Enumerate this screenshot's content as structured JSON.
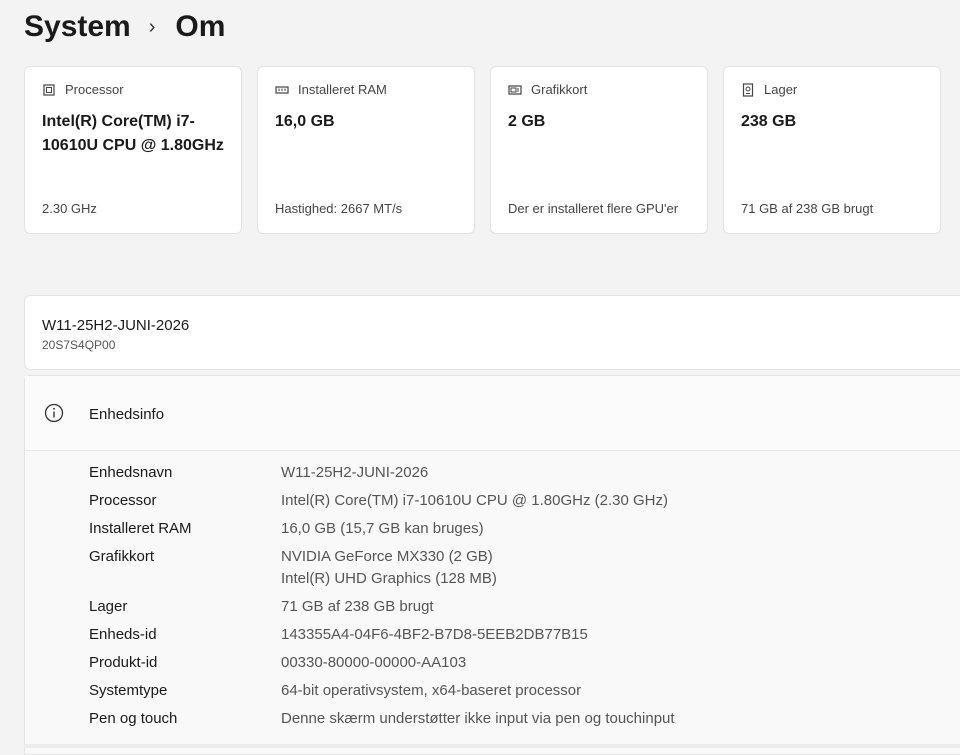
{
  "breadcrumb": {
    "parent": "System",
    "separator": "›",
    "current": "Om"
  },
  "cards": [
    {
      "icon": "processor-icon",
      "label": "Processor",
      "value": "Intel(R) Core(TM) i7-10610U CPU @ 1.80GHz",
      "sub": "2.30 GHz"
    },
    {
      "icon": "ram-icon",
      "label": "Installeret RAM",
      "value": "16,0 GB",
      "sub": "Hastighed: 2667 MT/s"
    },
    {
      "icon": "graphics-card-icon",
      "label": "Grafikkort",
      "value": "2 GB",
      "sub": "Der er installeret flere GPU'er"
    },
    {
      "icon": "storage-icon",
      "label": "Lager",
      "value": "238 GB",
      "sub": "71 GB af 238 GB brugt"
    }
  ],
  "device": {
    "name": "W11-25H2-JUNI-2026",
    "model": "20S7S4QP00"
  },
  "device_info": {
    "title": "Enhedsinfo",
    "rows": [
      {
        "label": "Enhedsnavn",
        "value": "W11-25H2-JUNI-2026"
      },
      {
        "label": "Processor",
        "value": "Intel(R) Core(TM) i7-10610U CPU @ 1.80GHz (2.30 GHz)"
      },
      {
        "label": "Installeret RAM",
        "value": "16,0 GB (15,7 GB kan bruges)"
      },
      {
        "label": "Grafikkort",
        "value": "NVIDIA GeForce MX330 (2 GB)",
        "value2": "Intel(R) UHD Graphics (128 MB)"
      },
      {
        "label": "Lager",
        "value": "71 GB af 238 GB brugt"
      },
      {
        "label": "Enheds-id",
        "value": "143355A4-04F6-4BF2-B7D8-5EEB2DB77B15"
      },
      {
        "label": "Produkt-id",
        "value": "00330-80000-00000-AA103"
      },
      {
        "label": "Systemtype",
        "value": "64-bit operativsystem, x64-baseret processor"
      },
      {
        "label": "Pen og touch",
        "value": "Denne skærm understøtter ikke input via pen og touchinput"
      }
    ]
  }
}
